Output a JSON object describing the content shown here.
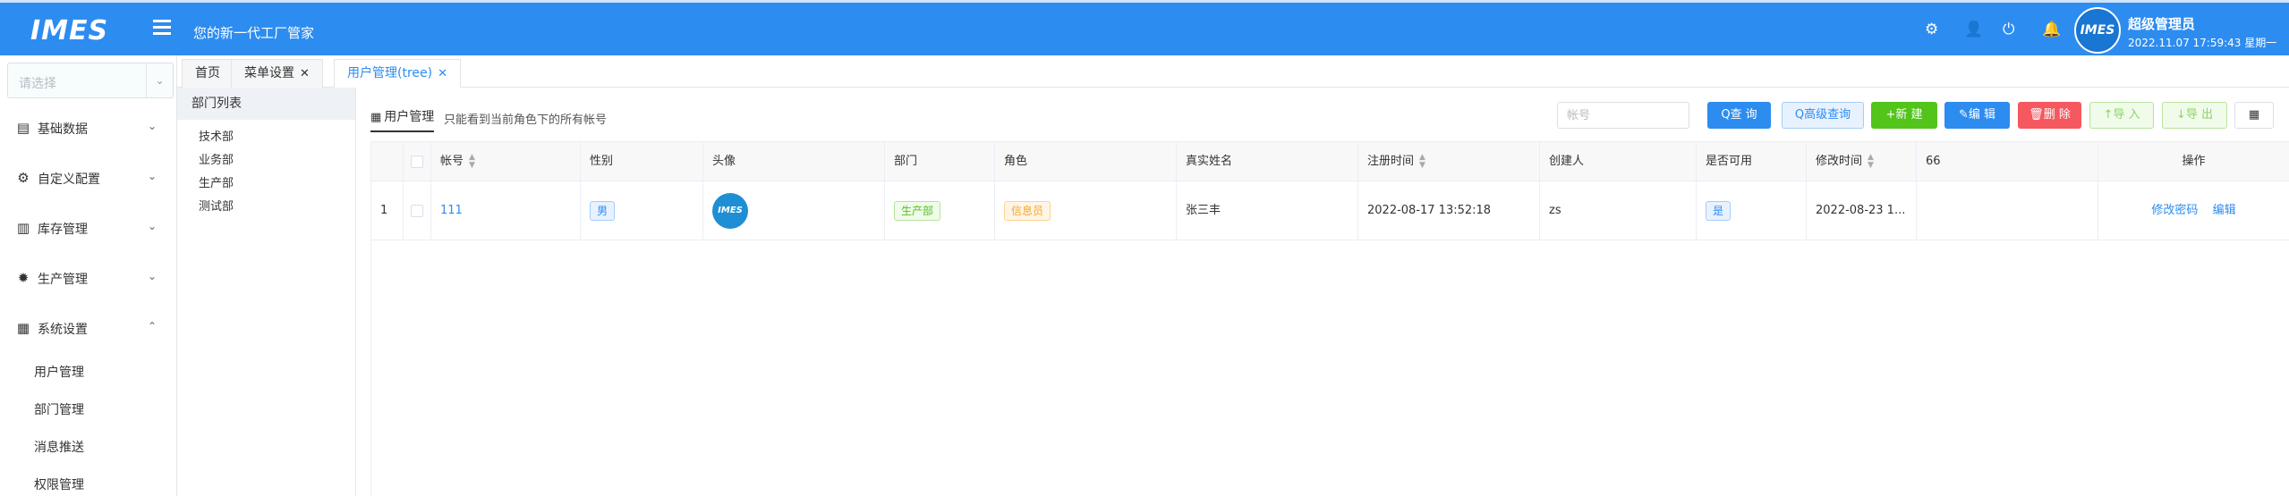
{
  "header": {
    "logo": "IMES",
    "slogan": "您的新一代工厂管家",
    "user_name": "超级管理员",
    "datetime": "2022.11.07 17:59:43 星期一",
    "avatar_text": "IMES",
    "icons": [
      "gear-icon",
      "user-icon",
      "power-icon",
      "bell-icon"
    ]
  },
  "sidebar": {
    "select_placeholder": "请选择",
    "groups": [
      {
        "label": "基础数据",
        "icon": "document-icon",
        "expanded": false
      },
      {
        "label": "自定义配置",
        "icon": "settings-icon",
        "expanded": false
      },
      {
        "label": "库存管理",
        "icon": "warehouse-icon",
        "expanded": false
      },
      {
        "label": "生产管理",
        "icon": "gear-icon",
        "expanded": false
      },
      {
        "label": "系统设置",
        "icon": "grid-icon",
        "expanded": true
      }
    ],
    "sub_items": [
      "用户管理",
      "部门管理",
      "消息推送",
      "权限管理"
    ]
  },
  "tabs": [
    {
      "label": "首页",
      "closable": false,
      "active": false
    },
    {
      "label": "菜单设置",
      "closable": true,
      "active": false
    },
    {
      "label": "用户管理(tree)",
      "closable": true,
      "active": true
    }
  ],
  "dept_panel": {
    "title": "部门列表",
    "items": [
      "技术部",
      "业务部",
      "生产部",
      "测试部"
    ]
  },
  "main": {
    "title": "用户管理",
    "subtitle": "只能看到当前角色下的所有帐号",
    "search_placeholder": "帐号",
    "buttons": {
      "query": "Q查 询",
      "advanced": "Q高级查询",
      "add": "+新 建",
      "edit": "编 辑",
      "delete": "删 除",
      "import": "↑导 入",
      "export": "↓导 出",
      "columns": "▦"
    },
    "columns": [
      "帐号",
      "性别",
      "头像",
      "部门",
      "角色",
      "真实姓名",
      "注册时间",
      "创建人",
      "是否可用",
      "修改时间",
      "66",
      "操作"
    ],
    "rows": [
      {
        "index": "1",
        "account": "111",
        "gender": "男",
        "avatar": "IMES",
        "dept": "生产部",
        "role": "信息员",
        "real_name": "张三丰",
        "register_time": "2022-08-17 13:52:18",
        "creator": "zs",
        "enabled": "是",
        "modify_time": "2022-08-23 1...",
        "col66": "",
        "action_reset": "修改密码",
        "action_edit": "编辑"
      }
    ]
  },
  "colors": {
    "primary": "#2d8cf0",
    "success": "#52c41a",
    "danger": "#f5585e",
    "warning": "#f5a623"
  }
}
